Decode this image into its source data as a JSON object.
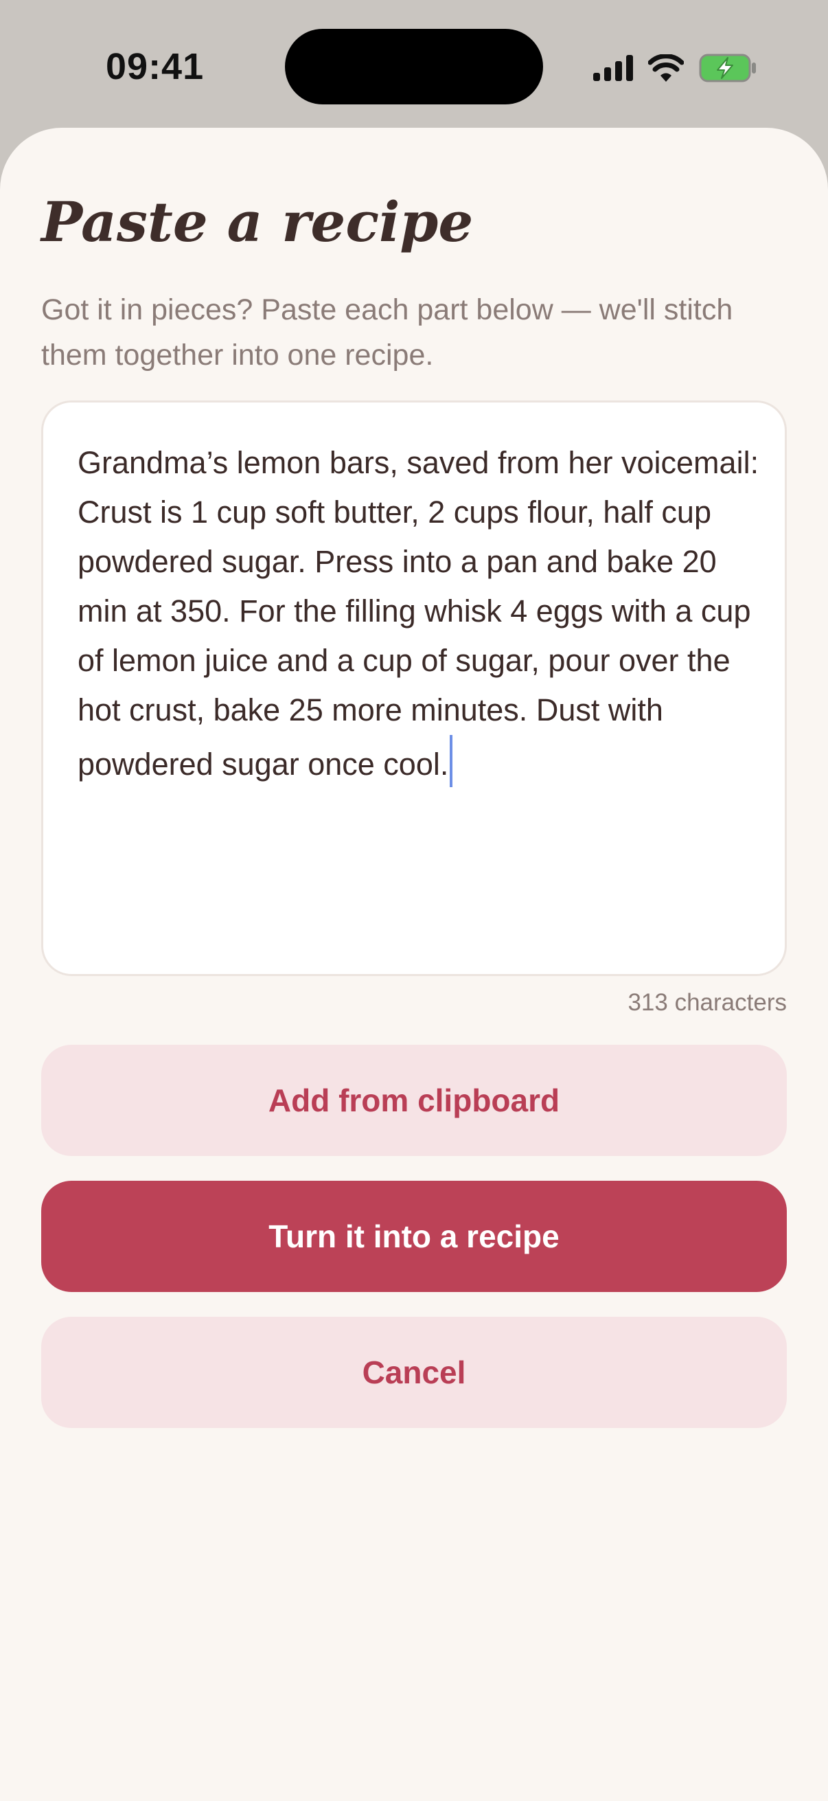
{
  "status_bar": {
    "time": "09:41",
    "icons": [
      "cellular-signal-icon",
      "wifi-icon",
      "battery-charging-icon"
    ]
  },
  "sheet": {
    "title": "Paste a recipe",
    "subtitle": "Got it in pieces? Paste each part below — we'll stitch them together into one recipe.",
    "editor": {
      "value": "Grandma’s lemon bars, saved from her voicemail: Crust is 1 cup soft butter, 2 cups flour, half cup powdered sugar. Press into a pan and bake 20 min at 350. For the filling whisk 4 eggs with a cup of lemon juice and a cup of sugar, pour over the hot crust, bake 25 more minutes. Dust with powdered sugar once cool."
    },
    "char_count": "313 characters",
    "buttons": {
      "clipboard": "Add from clipboard",
      "convert": "Turn it into a recipe",
      "cancel": "Cancel"
    }
  },
  "colors": {
    "accent": "#bc4257",
    "accent_soft": "#f6e3e5",
    "title_text": "#3e2d2a",
    "muted_text": "#8a7b77",
    "sheet_bg": "#faf6f2",
    "battery_green": "#5bc65a"
  }
}
